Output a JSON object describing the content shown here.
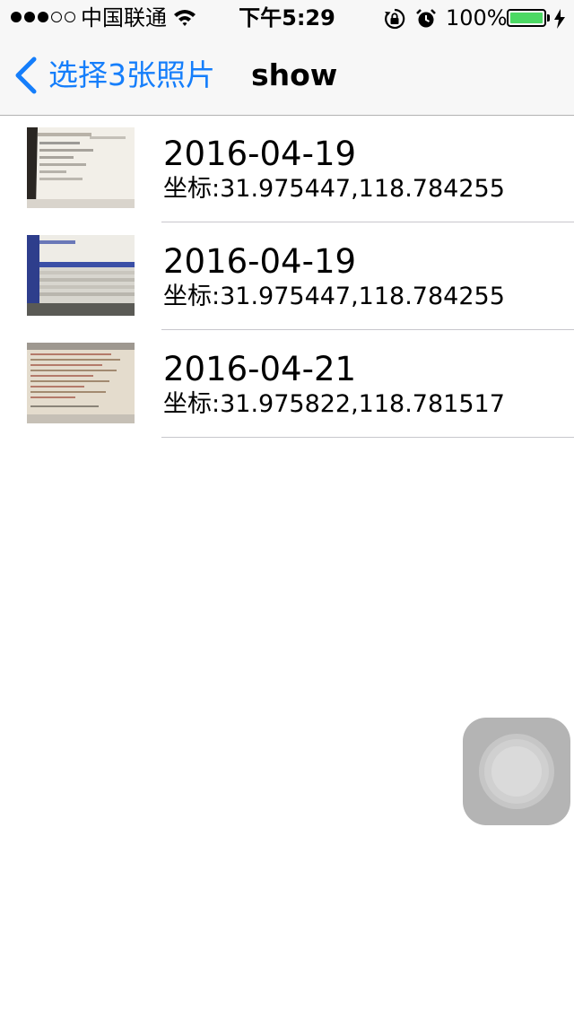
{
  "status_bar": {
    "carrier": "中国联通",
    "time": "下午5:29",
    "battery_percent": "100%",
    "battery_level": 1.0,
    "signal_strength": 3,
    "signal_max": 5
  },
  "nav": {
    "back_label": "选择3张照片",
    "title": "show",
    "accent_color": "#157efb"
  },
  "photos": [
    {
      "date": "2016-04-19",
      "coords": "坐标:31.975447,118.784255"
    },
    {
      "date": "2016-04-19",
      "coords": "坐标:31.975447,118.784255"
    },
    {
      "date": "2016-04-21",
      "coords": "坐标:31.975822,118.781517"
    }
  ]
}
